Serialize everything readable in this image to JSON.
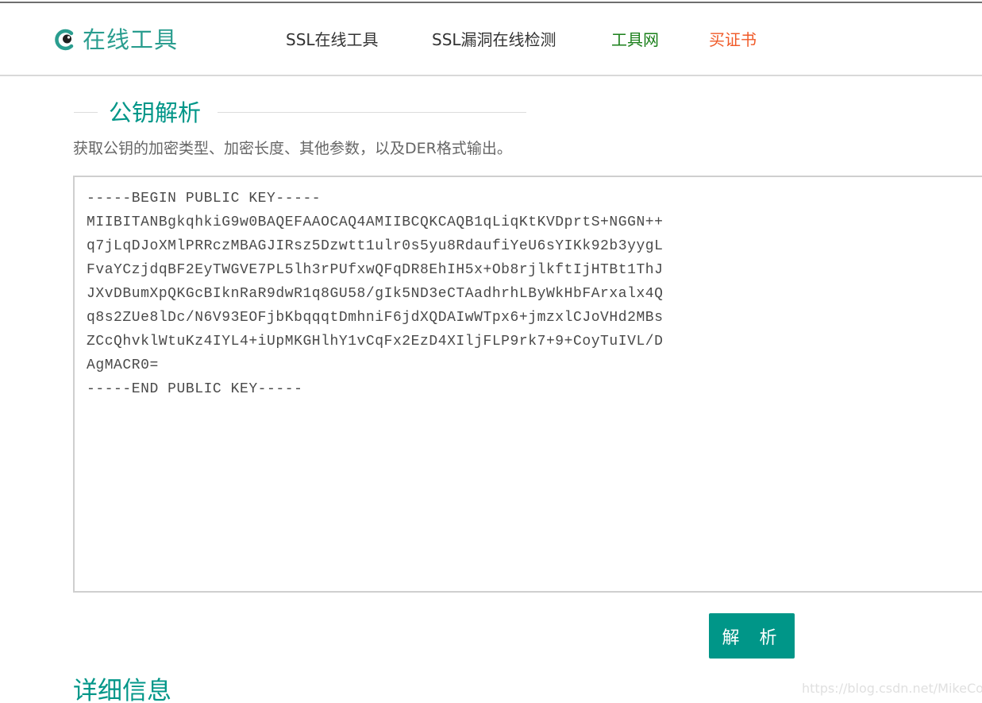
{
  "colors": {
    "accent": "#009688",
    "nav_text": "#333333",
    "tool_net": "#1a7f1a",
    "buy_cert": "#f05a28",
    "description": "#666666",
    "border": "#cfcfcf"
  },
  "header": {
    "logo_icon": "eye-logo-icon",
    "logo_text": "在线工具",
    "nav": [
      {
        "label": "SSL在线工具"
      },
      {
        "label": "SSL漏洞在线检测"
      },
      {
        "label": "工具网"
      },
      {
        "label": "买证书"
      }
    ]
  },
  "main": {
    "section_title": "公钥解析",
    "description": "获取公钥的加密类型、加密长度、其他参数，以及DER格式输出。",
    "public_key_value": "-----BEGIN PUBLIC KEY-----\nMIIBITANBgkqhkiG9w0BAQEFAAOCAQ4AMIIBCQKCAQB1qLiqKtKVDprtS+NGGN++\nq7jLqDJoXMlPRRczMBAGJIRsz5Dzwtt1ulr0s5yu8RdaufiYeU6sYIKk92b3yygL\nFvaYCzjdqBF2EyTWGVE7PL5lh3rPUfxwQFqDR8EhIH5x+Ob8rjlkftIjHTBt1ThJ\nJXvDBumXpQKGcBIknRaR9dwR1q8GU58/gIk5ND3eCTAadhrhLByWkHbFArxalx4Q\nq8s2ZUe8lDc/N6V93EOFjbKbqqqtDmhniF6jdXQDAIwWTpx6+jmzxlCJoVHd2MBs\nZCcQhvklWtuKz4IYL4+iUpMKGHlhY1vCqFx2EzD4XIljFLP9rk7+9+CoyTuIVL/D\nAgMACR0=\n-----END PUBLIC KEY-----",
    "parse_button_label": "解 析",
    "detail_title": "详细信息"
  },
  "watermark": "https://blog.csdn.net/MikeCoke"
}
